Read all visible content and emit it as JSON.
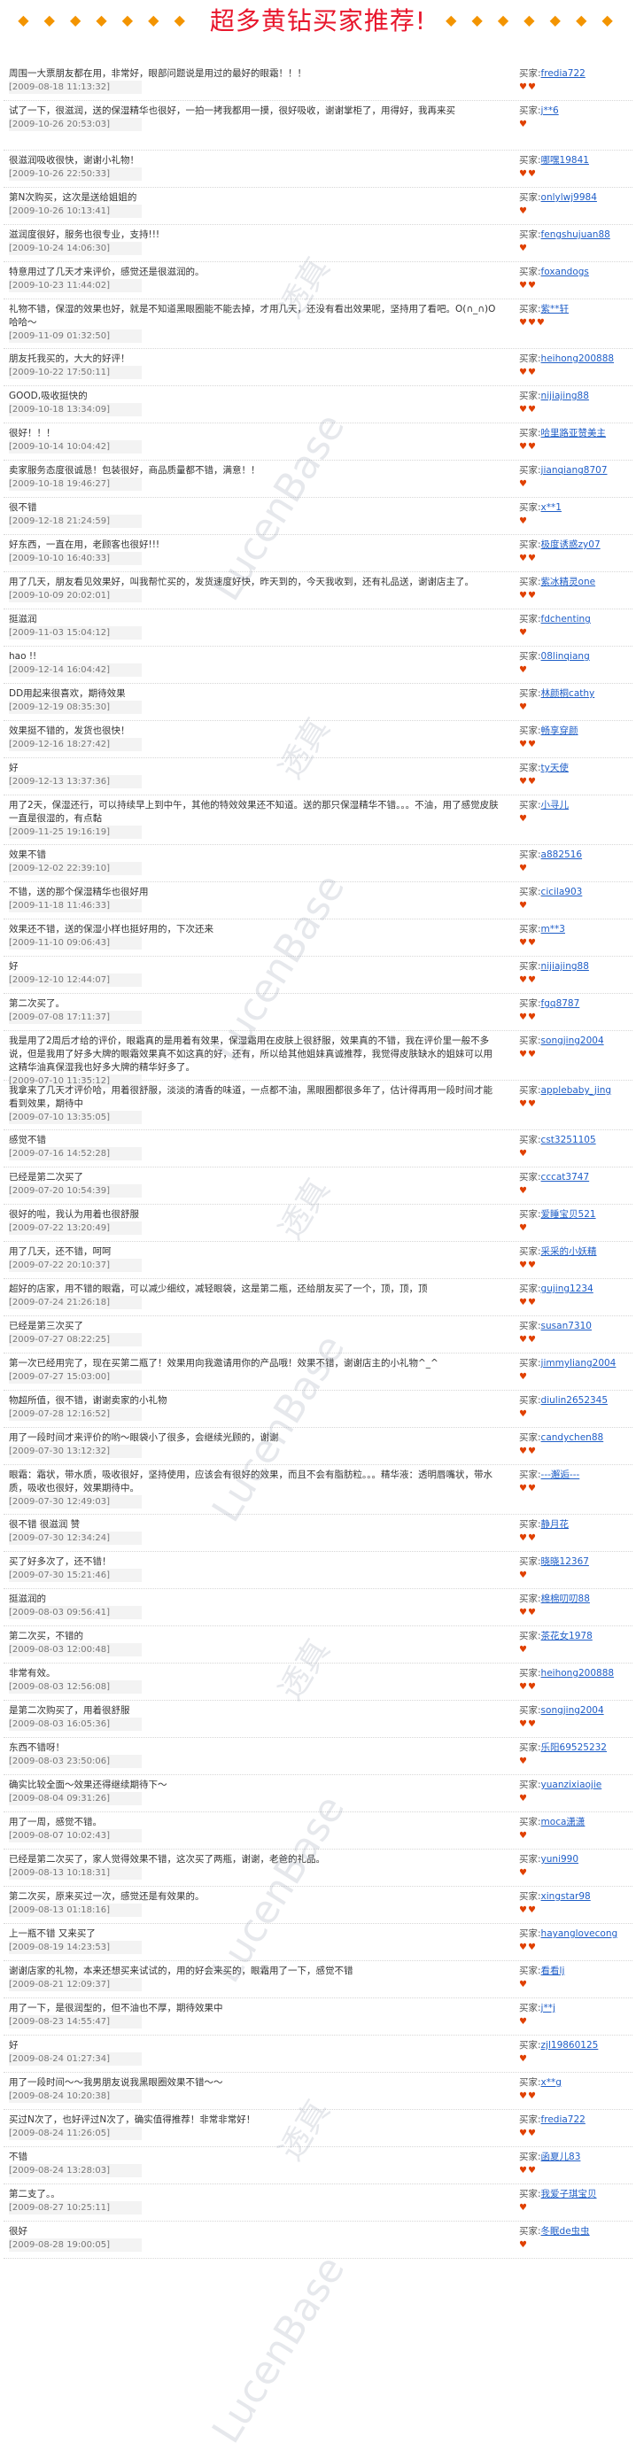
{
  "header": {
    "gems_left": "◆ ◆ ◆ ◆ ◆ ◆ ◆",
    "title": "超多黄钻买家推荐!",
    "gems_right": "◆ ◆ ◆ ◆ ◆ ◆ ◆"
  },
  "watermark": {
    "cn": "透真",
    "en": "LucenBase"
  },
  "buyer_label": "买家:",
  "reviews": [
    {
      "comment": "周围一大票朋友都在用，非常好，眼部问题说是用过的最好的眼霜！！！",
      "date": "[2009-08-18 11:13:32]",
      "buyer": "fredia722",
      "hearts": "♥♥"
    },
    {
      "comment": "试了一下，很滋润，送的保湿精华也很好，一拍一拷我都用一摸，很好吸收，谢谢掌柜了，用得好，我再来买",
      "date": "[2009-10-26 20:53:03]",
      "buyer": "j**6",
      "hearts": "♥"
    },
    {
      "comment": "很滋润吸收很快，谢谢小礼物！",
      "date": "[2009-10-26 22:50:33]",
      "buyer": "哪嘿19841",
      "hearts": "♥♥"
    },
    {
      "comment": "第N次购买，这次是送给姐姐的",
      "date": "[2009-10-26 10:13:41]",
      "buyer": "onlylwj9984",
      "hearts": "♥"
    },
    {
      "comment": "滋润度很好，服务也很专业，支持!!!",
      "date": "[2009-10-24 14:06:30]",
      "buyer": "fengshujuan88",
      "hearts": "♥"
    },
    {
      "comment": "特意用过了几天才来评价，感觉还是很滋润的。",
      "date": "[2009-10-23 11:44:02]",
      "buyer": "foxandogs",
      "hearts": "♥♥"
    },
    {
      "comment": "礼物不错，保湿的效果也好，就是不知道黑眼圈能不能去掉，才用几天，还没有看出效果呢，坚持用了看吧。O(∩_∩)O哈哈～",
      "date": "[2009-11-09 01:32:50]",
      "buyer": "紫**轩",
      "hearts": "♥♥♥"
    },
    {
      "comment": "朋友托我买的，大大的好评！",
      "date": "[2009-10-22 17:50:11]",
      "buyer": "heihong200888",
      "hearts": "♥♥"
    },
    {
      "comment": "GOOD,吸收挺快的",
      "date": "[2009-10-18 13:34:09]",
      "buyer": "nijiajing88",
      "hearts": "♥♥"
    },
    {
      "comment": "很好！！！",
      "date": "[2009-10-14 10:04:42]",
      "buyer": "哈里路亚赞美主",
      "hearts": "♥♥"
    },
    {
      "comment": "卖家服务态度很诚恳！包装很好，商品质量都不错，满意！！",
      "date": "[2009-10-18 19:46:27]",
      "buyer": "jianqiang8707",
      "hearts": "♥"
    },
    {
      "comment": "很不错",
      "date": "[2009-12-18 21:24:59]",
      "buyer": "x**1",
      "hearts": "♥"
    },
    {
      "comment": "好东西，一直在用，老顾客也很好!!!",
      "date": "[2009-10-10 16:40:33]",
      "buyer": "极度诱惑zy07",
      "hearts": "♥♥"
    },
    {
      "comment": "用了几天，朋友看见效果好，叫我帮忙买的，发货速度好快，昨天到的，今天我收到，还有礼品送，谢谢店主了。",
      "date": "[2009-10-09 20:02:01]",
      "buyer": "紫冰精灵one",
      "hearts": "♥♥"
    },
    {
      "comment": "挺滋润",
      "date": "[2009-11-03 15:04:12]",
      "buyer": "fdchenting",
      "hearts": "♥"
    },
    {
      "comment": "hao !!",
      "date": "[2009-12-14 16:04:42]",
      "buyer": "08linqiang",
      "hearts": "♥"
    },
    {
      "comment": "DD用起来很喜欢，期待效果",
      "date": "[2009-12-19 08:35:30]",
      "buyer": "林颜桐cathy",
      "hearts": "♥"
    },
    {
      "comment": "效果挺不错的，发货也很快！",
      "date": "[2009-12-16 18:27:42]",
      "buyer": "畅享穿颜",
      "hearts": "♥♥"
    },
    {
      "comment": "好",
      "date": "[2009-12-13 13:37:36]",
      "buyer": "ty天使",
      "hearts": "♥♥"
    },
    {
      "comment": "用了2天，保湿还行，可以持续早上到中午，其他的特效效果还不知道。送的那只保湿精华不错。。。不油，用了感觉皮肤一直是很湿的，有点黏",
      "date": "[2009-11-25 19:16:19]",
      "buyer": "小寻儿",
      "hearts": "♥"
    },
    {
      "comment": "效果不错",
      "date": "[2009-12-02 22:39:10]",
      "buyer": "a882516",
      "hearts": "♥"
    },
    {
      "comment": "不错，送的那个保湿精华也很好用",
      "date": "[2009-11-18 11:46:33]",
      "buyer": "cicila903",
      "hearts": "♥"
    },
    {
      "comment": "效果还不错，送的保湿小样也挺好用的，下次还来",
      "date": "[2009-11-10 09:06:43]",
      "buyer": "m**3",
      "hearts": "♥♥"
    },
    {
      "comment": "好",
      "date": "[2009-12-10 12:44:07]",
      "buyer": "nijiajing88",
      "hearts": "♥♥"
    },
    {
      "comment": "第二次买了。",
      "date": "[2009-07-08 17:11:37]",
      "buyer": "fgq8787",
      "hearts": "♥♥"
    },
    {
      "comment": "我是用了2周后才给的评价，眼霜真的是用着有效果，保湿霜用在皮肤上很舒服，效果真的不错，我在评价里一般不多说，但是我用了好多大牌的眼霜效果真不如这真的好，还有，所以给其他姐妹真诚推荐，我觉得皮肤缺水的姐妹可以用这精华油真保湿我也好多大牌的精华好多了。",
      "date": "[2009-07-10 11:35:12]",
      "buyer": "songjing2004",
      "hearts": "♥♥"
    },
    {
      "comment": "我拿来了几天才评价哈，用着很舒服，淡淡的清香的味道，一点都不油，黑眼圈都很多年了，估计得再用一段时间才能看到效果，期待中",
      "date": "[2009-07-10 13:35:05]",
      "buyer": "applebaby_jing",
      "hearts": "♥♥"
    },
    {
      "comment": "感觉不错",
      "date": "[2009-07-16 14:52:28]",
      "buyer": "cst3251105",
      "hearts": "♥"
    },
    {
      "comment": "已经是第二次买了",
      "date": "[2009-07-20 10:54:39]",
      "buyer": "cccat3747",
      "hearts": "♥"
    },
    {
      "comment": "很好的啦，我认为用着也很舒服",
      "date": "[2009-07-22 13:20:49]",
      "buyer": "爱睡宝贝521",
      "hearts": "♥"
    },
    {
      "comment": "用了几天，还不错，呵呵",
      "date": "[2009-07-22 20:10:37]",
      "buyer": "采采的小妖精",
      "hearts": "♥♥"
    },
    {
      "comment": "超好的店家，用不错的眼霜，可以减少细纹，减轻眼袋，这是第二瓶，还给朋友买了一个，顶，顶，顶",
      "date": "[2009-07-24 21:26:18]",
      "buyer": "gujing1234",
      "hearts": "♥♥"
    },
    {
      "comment": "已经是第三次买了",
      "date": "[2009-07-27 08:22:25]",
      "buyer": "susan7310",
      "hearts": "♥♥"
    },
    {
      "comment": "第一次已经用完了，现在买第二瓶了！效果用向我邀请用你的产品哦！效果不错，谢谢店主的小礼物^_^",
      "date": "[2009-07-27 15:03:00]",
      "buyer": "jimmyliang2004",
      "hearts": "♥"
    },
    {
      "comment": "物超所值，很不错，谢谢卖家的小礼物",
      "date": "[2009-07-28 12:16:52]",
      "buyer": "diulin2652345",
      "hearts": "♥"
    },
    {
      "comment": "用了一段时间才来评价的哟～眼袋小了很多，会继续光顾的，谢谢",
      "date": "[2009-07-30 13:12:32]",
      "buyer": "candychen88",
      "hearts": "♥♥"
    },
    {
      "comment": "眼霜：霜状，带水质，吸收很好，坚持使用，应该会有很好的效果，而且不会有脂肪粒。。。精华液：透明唇嘴状，带水质，吸收也很好，效果期待中。",
      "date": "[2009-07-30 12:49:03]",
      "buyer": "---邂逅---",
      "hearts": "♥♥"
    },
    {
      "comment": "很不错 很滋润 赞",
      "date": "[2009-07-30 12:34:24]",
      "buyer": "静月花",
      "hearts": "♥♥"
    },
    {
      "comment": "买了好多次了，还不错！",
      "date": "[2009-07-30 15:21:46]",
      "buyer": "晓晓12367",
      "hearts": "♥"
    },
    {
      "comment": "挺滋润的",
      "date": "[2009-08-03 09:56:41]",
      "buyer": "棉棉叨叨88",
      "hearts": "♥♥"
    },
    {
      "comment": "第二次买，不错的",
      "date": "[2009-08-03 12:00:48]",
      "buyer": "茶花女1978",
      "hearts": "♥"
    },
    {
      "comment": "非常有效。",
      "date": "[2009-08-03 12:56:08]",
      "buyer": "heihong200888",
      "hearts": "♥♥"
    },
    {
      "comment": "是第二次购买了，用着很舒服",
      "date": "[2009-08-03 16:05:36]",
      "buyer": "songjing2004",
      "hearts": "♥♥"
    },
    {
      "comment": "东西不错呀！",
      "date": "[2009-08-03 23:50:06]",
      "buyer": "乐阳69525232",
      "hearts": "♥"
    },
    {
      "comment": "确实比较全面～效果还得继续期待下～",
      "date": "[2009-08-04 09:31:26]",
      "buyer": "yuanzixiaojie",
      "hearts": "♥"
    },
    {
      "comment": "用了一周，感觉不错。",
      "date": "[2009-08-07 10:02:43]",
      "buyer": "moca潇潇",
      "hearts": "♥"
    },
    {
      "comment": "已经是第二次买了，家人觉得效果不错，这次买了两瓶，谢谢，老爸的礼品。",
      "date": "[2009-08-13 10:18:31]",
      "buyer": "yuni990",
      "hearts": "♥"
    },
    {
      "comment": "第二次买，原来买过一次，感觉还是有效果的。",
      "date": "[2009-08-13 01:18:16]",
      "buyer": "xingstar98",
      "hearts": "♥♥"
    },
    {
      "comment": "上一瓶不错 又来买了",
      "date": "[2009-08-19 14:23:53]",
      "buyer": "hayanglovecong",
      "hearts": "♥♥"
    },
    {
      "comment": "谢谢店家的礼物，本来还想买来试试的，用的好会来买的，眼霜用了一下，感觉不错",
      "date": "[2009-08-21 12:09:37]",
      "buyer": "看看lj",
      "hearts": "♥"
    },
    {
      "comment": "用了一下，是很润型的，但不油也不厚，期待效果中",
      "date": "[2009-08-23 14:55:47]",
      "buyer": "j**j",
      "hearts": "♥"
    },
    {
      "comment": "好",
      "date": "[2009-08-24 01:27:34]",
      "buyer": "zjl19860125",
      "hearts": "♥"
    },
    {
      "comment": "用了一段时间～～我男朋友说我黑眼圈效果不错～～",
      "date": "[2009-08-24 10:20:38]",
      "buyer": "x**g",
      "hearts": "♥♥"
    },
    {
      "comment": "买过N次了，也好评过N次了，确实值得推荐！非常非常好！",
      "date": "[2009-08-24 11:26:05]",
      "buyer": "fredia722",
      "hearts": "♥♥"
    },
    {
      "comment": "不错",
      "date": "[2009-08-24 13:28:03]",
      "buyer": "函夏儿83",
      "hearts": "♥♥"
    },
    {
      "comment": "第二支了。。",
      "date": "[2009-08-27 10:25:11]",
      "buyer": "我爱子琪宝贝",
      "hearts": "♥"
    },
    {
      "comment": "很好",
      "date": "[2009-08-28 19:00:05]",
      "buyer": "冬眠de虫虫",
      "hearts": "♥"
    }
  ]
}
